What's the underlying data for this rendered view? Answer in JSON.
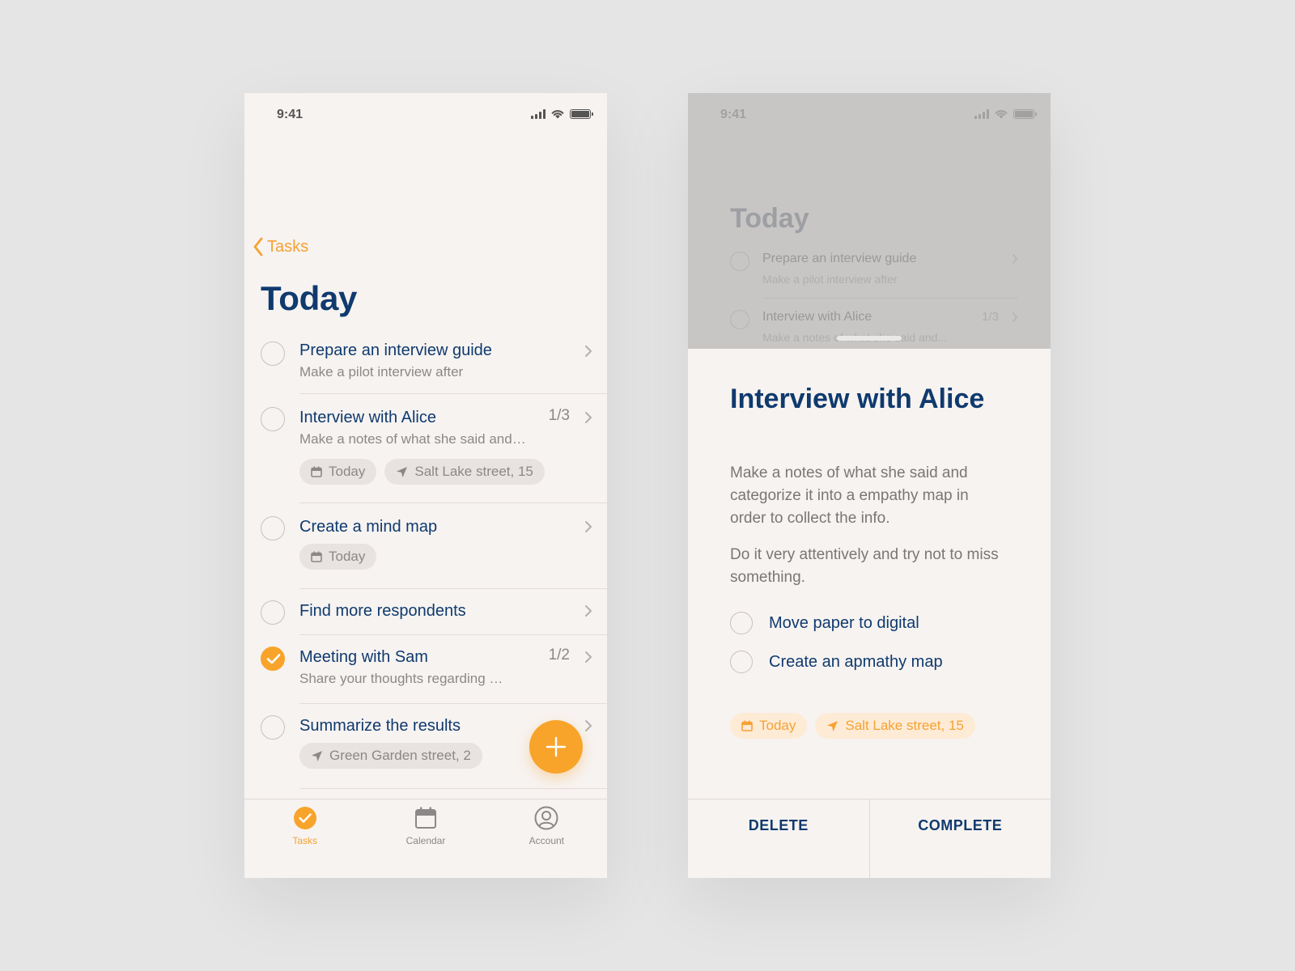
{
  "colors": {
    "accent": "#f8a42b",
    "title": "#0f3a6e",
    "muted": "#8c8887",
    "background": "#f7f3f1"
  },
  "left": {
    "status_time": "9:41",
    "back_label": "Tasks",
    "title": "Today",
    "tasks": [
      {
        "title": "Prepare an interview guide",
        "subtitle": "Make a pilot interview after"
      },
      {
        "title": "Interview with Alice",
        "count": "1/3",
        "subtitle": "Make a notes of what she said and…",
        "chip_date": "Today",
        "chip_location": "Salt Lake street, 15"
      },
      {
        "title": "Create a mind map",
        "chip_date": "Today"
      },
      {
        "title": "Find more respondents"
      },
      {
        "title": "Meeting with Sam",
        "count": "1/2",
        "subtitle": "Share your thoughts regarding …",
        "done": true
      },
      {
        "title": "Summarize the results",
        "chip_location": "Green Garden street, 2"
      }
    ],
    "tabs": [
      {
        "label": "Tasks",
        "icon": "check-circle-icon",
        "active": true
      },
      {
        "label": "Calendar",
        "icon": "calendar-icon"
      },
      {
        "label": "Account",
        "icon": "user-circle-icon"
      }
    ]
  },
  "right": {
    "status_time": "9:41",
    "bg_title": "Today",
    "bg_tasks": [
      {
        "title": "Prepare an interview guide",
        "subtitle": "Make a pilot interview after"
      },
      {
        "title": "Interview with Alice",
        "count": "1/3",
        "subtitle": "Make a notes of what she said and..."
      }
    ],
    "sheet": {
      "title": "Interview with Alice",
      "paragraph1": "Make a notes of what she said and categorize it into a empathy map in order to collect the info.",
      "paragraph2": "Do it very attentively and try not to miss something.",
      "subtasks": [
        "Move paper to digital",
        "Create an apmathy map"
      ],
      "chip_date": "Today",
      "chip_location": "Salt Lake street, 15",
      "delete_label": "DELETE",
      "complete_label": "COMPLETE"
    }
  }
}
